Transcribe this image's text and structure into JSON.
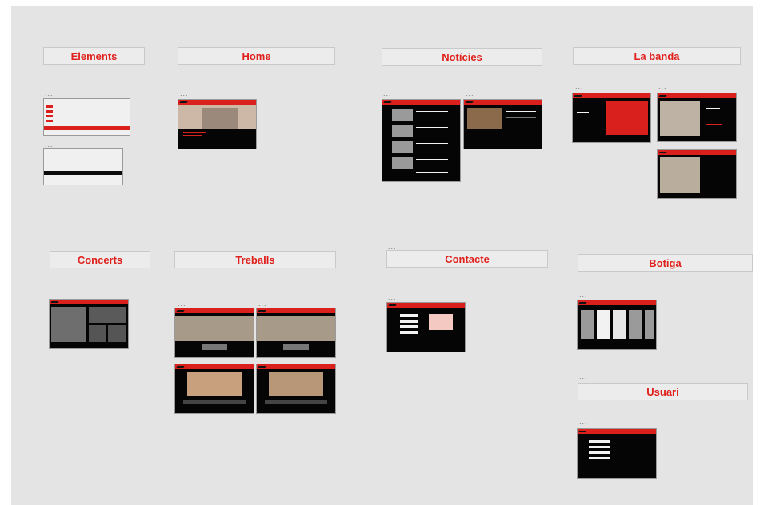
{
  "canvas": {
    "background": "#e4e4e4",
    "frame_menu": "..."
  },
  "sections": {
    "elements": "Elements",
    "home": "Home",
    "noticies": "Notícies",
    "la_banda": "La banda",
    "concerts": "Concerts",
    "treballs": "Treballs",
    "contacte": "Contacte",
    "botiga": "Botiga",
    "usuari": "Usuari"
  },
  "colors": {
    "accent": "#e0201c",
    "frame_dark": "#050505",
    "label_bg": "#ececec"
  }
}
